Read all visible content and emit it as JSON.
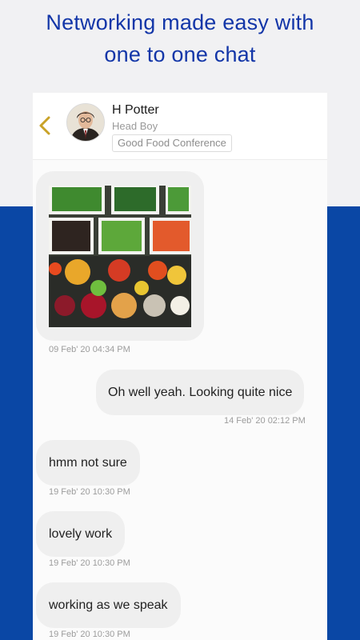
{
  "headline": {
    "line1": "Networking made easy with",
    "line2": "one to one chat"
  },
  "contact": {
    "name": "H Potter",
    "role": "Head Boy",
    "event": "Good Food Conference"
  },
  "colors": {
    "brand_blue": "#0a47a5",
    "headline_blue": "#1336a8",
    "back_gold": "#c9a227",
    "bubble_bg": "#efefef"
  },
  "messages": [
    {
      "type": "image",
      "direction": "in",
      "image": "assorted vegetables in bowls",
      "time": "09 Feb' 20 04:34 PM"
    },
    {
      "type": "text",
      "direction": "out",
      "text": "Oh well yeah. Looking quite nice",
      "time": "14 Feb' 20 02:12 PM"
    },
    {
      "type": "text",
      "direction": "in",
      "text": "hmm not sure",
      "time": "19 Feb' 20 10:30 PM"
    },
    {
      "type": "text",
      "direction": "in",
      "text": "lovely work",
      "time": "19 Feb' 20 10:30 PM"
    },
    {
      "type": "text",
      "direction": "in",
      "text": "working as we speak",
      "time": "19 Feb' 20 10:30 PM"
    }
  ]
}
